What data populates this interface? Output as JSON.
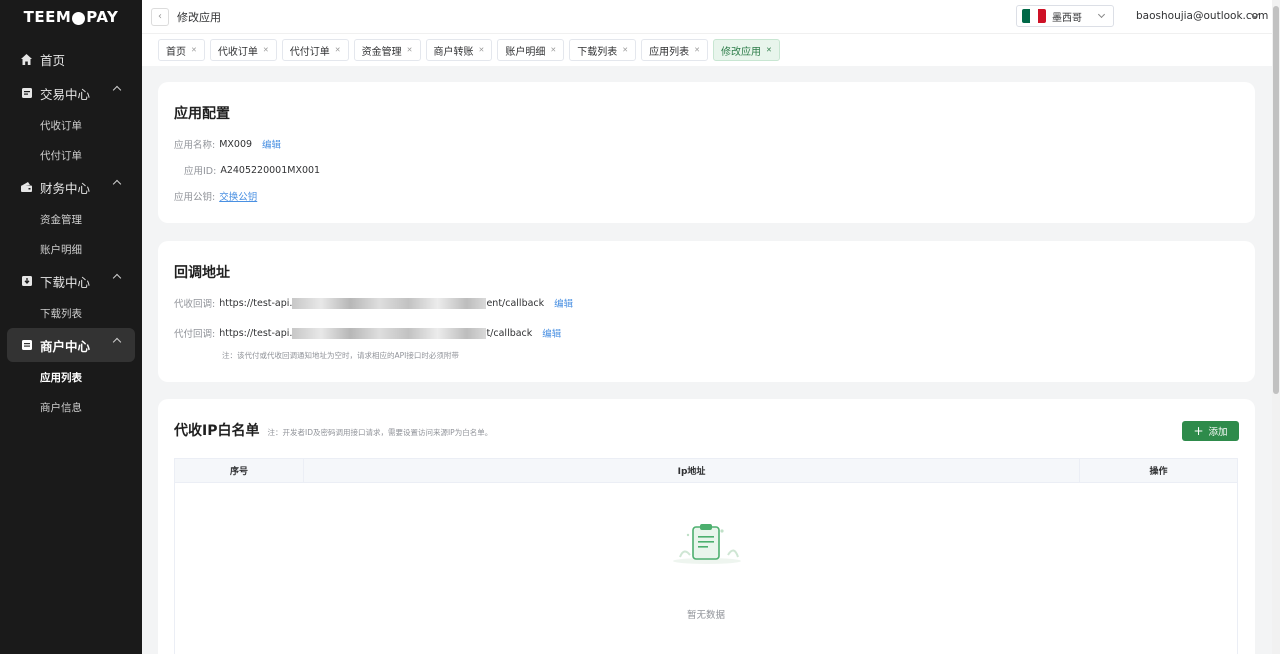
{
  "brand": {
    "logo_left": "TEEM",
    "logo_right": "PAY"
  },
  "sidebar": {
    "home": "首页",
    "groups": [
      {
        "label": "交易中心",
        "items": [
          "代收订单",
          "代付订单"
        ]
      },
      {
        "label": "财务中心",
        "items": [
          "资金管理",
          "账户明细"
        ]
      },
      {
        "label": "下载中心",
        "items": [
          "下载列表"
        ]
      },
      {
        "label": "商户中心",
        "items": [
          "应用列表",
          "商户信息"
        ]
      }
    ]
  },
  "header": {
    "breadcrumb": "修改应用",
    "country": "墨西哥",
    "user_email": "baoshoujia@outlook.com",
    "colors": {
      "flag_green": "#006847",
      "flag_white": "#ffffff",
      "flag_red": "#ce1126"
    }
  },
  "tabs": [
    "首页",
    "代收订单",
    "代付订单",
    "资金管理",
    "商户转账",
    "账户明细",
    "下载列表",
    "应用列表",
    "修改应用"
  ],
  "active_tab": "修改应用",
  "app_config": {
    "title": "应用配置",
    "name_label": "应用名称:",
    "name_value": "MX009",
    "edit": "编辑",
    "id_label": "应用ID:",
    "id_value": "A2405220001MX001",
    "pubkey_label": "应用公钥:",
    "pubkey_link": "交换公钥"
  },
  "callback": {
    "title": "回调地址",
    "collect_label": "代收回调:",
    "collect_prefix": "https://test-api.",
    "collect_suffix": "ent/callback",
    "pay_label": "代付回调:",
    "pay_prefix": "https://test-api.",
    "pay_suffix": "t/callback",
    "edit": "编辑",
    "note": "注：该代付或代收回调通知地址为空时，请求相应的API接口时必须附带"
  },
  "whitelist": {
    "title": "代收IP白名单",
    "note": "注：开发者ID及密码调用接口请求，需要设置访问来源IP为白名单。",
    "add_button": "添加",
    "columns": [
      "序号",
      "Ip地址",
      "操作"
    ],
    "empty_text": "暂无数据"
  },
  "accent_color": "#2e8b4b"
}
